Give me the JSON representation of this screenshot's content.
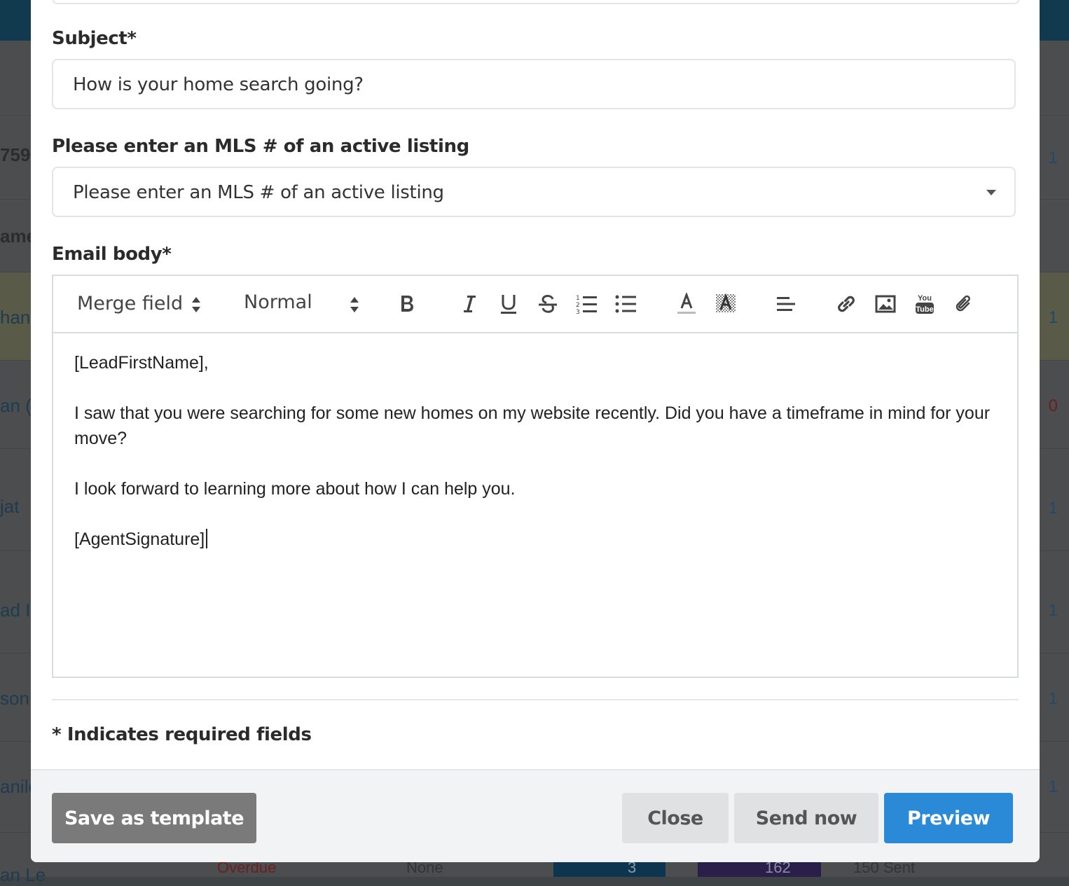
{
  "background": {
    "fragments": [
      "759",
      "ame",
      "han",
      "an (",
      "jat",
      "ad I",
      "son",
      "anilo",
      "an Le"
    ],
    "row_values": [
      "1",
      "1",
      "0",
      "1",
      "1",
      "1",
      "1"
    ],
    "bottom_text": [
      "Overdue",
      "None",
      "3",
      "162",
      "150 Sent"
    ]
  },
  "form": {
    "subject_label": "Subject*",
    "subject_value": "How is your home search going?",
    "mls_label": "Please enter an MLS # of an active listing",
    "mls_placeholder": "Please enter an MLS # of an active listing",
    "body_label": "Email body*",
    "required_note": "* Indicates required fields"
  },
  "toolbar": {
    "merge_field": "Merge field",
    "text_style": "Normal",
    "icons": [
      "bold-icon",
      "italic-icon",
      "underline-icon",
      "strikethrough-icon",
      "ordered-list-icon",
      "bullet-list-icon",
      "text-color-icon",
      "highlight-color-icon",
      "align-left-icon",
      "link-icon",
      "image-icon",
      "youtube-icon",
      "attachment-icon"
    ],
    "youtube_text_top": "You",
    "youtube_text_bottom": "Tube"
  },
  "email_body": {
    "greeting": "[LeadFirstName],",
    "paragraph1": "I saw that you were searching for some new homes on my website recently. Did you have a timeframe in mind for your move?",
    "paragraph2": "I look forward to learning more about how I can help you.",
    "signature": "[AgentSignature]"
  },
  "buttons": {
    "save_template": "Save as template",
    "close": "Close",
    "send_now": "Send now",
    "preview": "Preview"
  },
  "colors": {
    "primary": "#2b8ad8",
    "secondary": "#7a7a7a",
    "neutral_button": "#e0e1e3"
  }
}
